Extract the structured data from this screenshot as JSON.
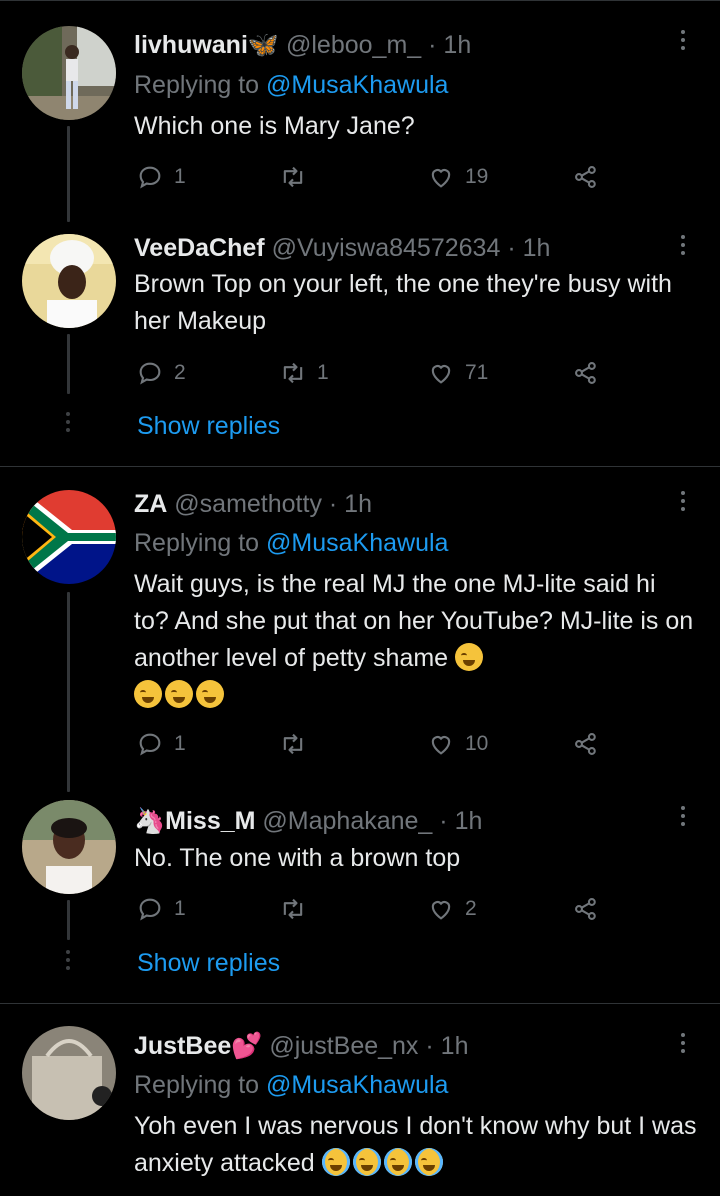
{
  "tweets": [
    {
      "name": "livhuwani",
      "name_emoji": "🦋",
      "handle": "@leboo_m_",
      "time": "· 1h",
      "replying_prefix": "Replying to",
      "replying_to": "@MusaKhawula",
      "text": "Which one is Mary Jane?",
      "replies": "1",
      "retweets": "",
      "likes": "19"
    },
    {
      "name": "VeeDaChef",
      "handle": "@Vuyiswa84572634",
      "time": "· 1h",
      "text": "Brown Top on your left, the one they're busy with her Makeup",
      "replies": "2",
      "retweets": "1",
      "likes": "71"
    },
    {
      "name": "ZA",
      "handle": "@samethotty",
      "time": "· 1h",
      "replying_prefix": "Replying to",
      "replying_to": "@MusaKhawula",
      "text": "Wait guys, is the real MJ the one MJ-lite said hi to? And she put that on her YouTube? MJ-lite is on another level of petty shame",
      "replies": "1",
      "retweets": "",
      "likes": "10"
    },
    {
      "name": "Miss_M",
      "name_emoji": "🦄",
      "handle": "@Maphakane_",
      "time": "· 1h",
      "text": "No. The one with a brown top",
      "replies": "1",
      "retweets": "",
      "likes": "2"
    },
    {
      "name": "JustBee",
      "name_emoji": "💕",
      "handle": "@justBee_nx",
      "time": "· 1h",
      "replying_prefix": "Replying to",
      "replying_to": "@MusaKhawula",
      "text": "Yoh even I was nervous I don't know why but I was anxiety attacked"
    }
  ],
  "show_replies_label": "Show replies",
  "colors": {
    "background": "#000000",
    "text": "#e7e9ea",
    "muted": "#71767b",
    "link": "#1d9bf0",
    "divider": "#2f3336"
  }
}
